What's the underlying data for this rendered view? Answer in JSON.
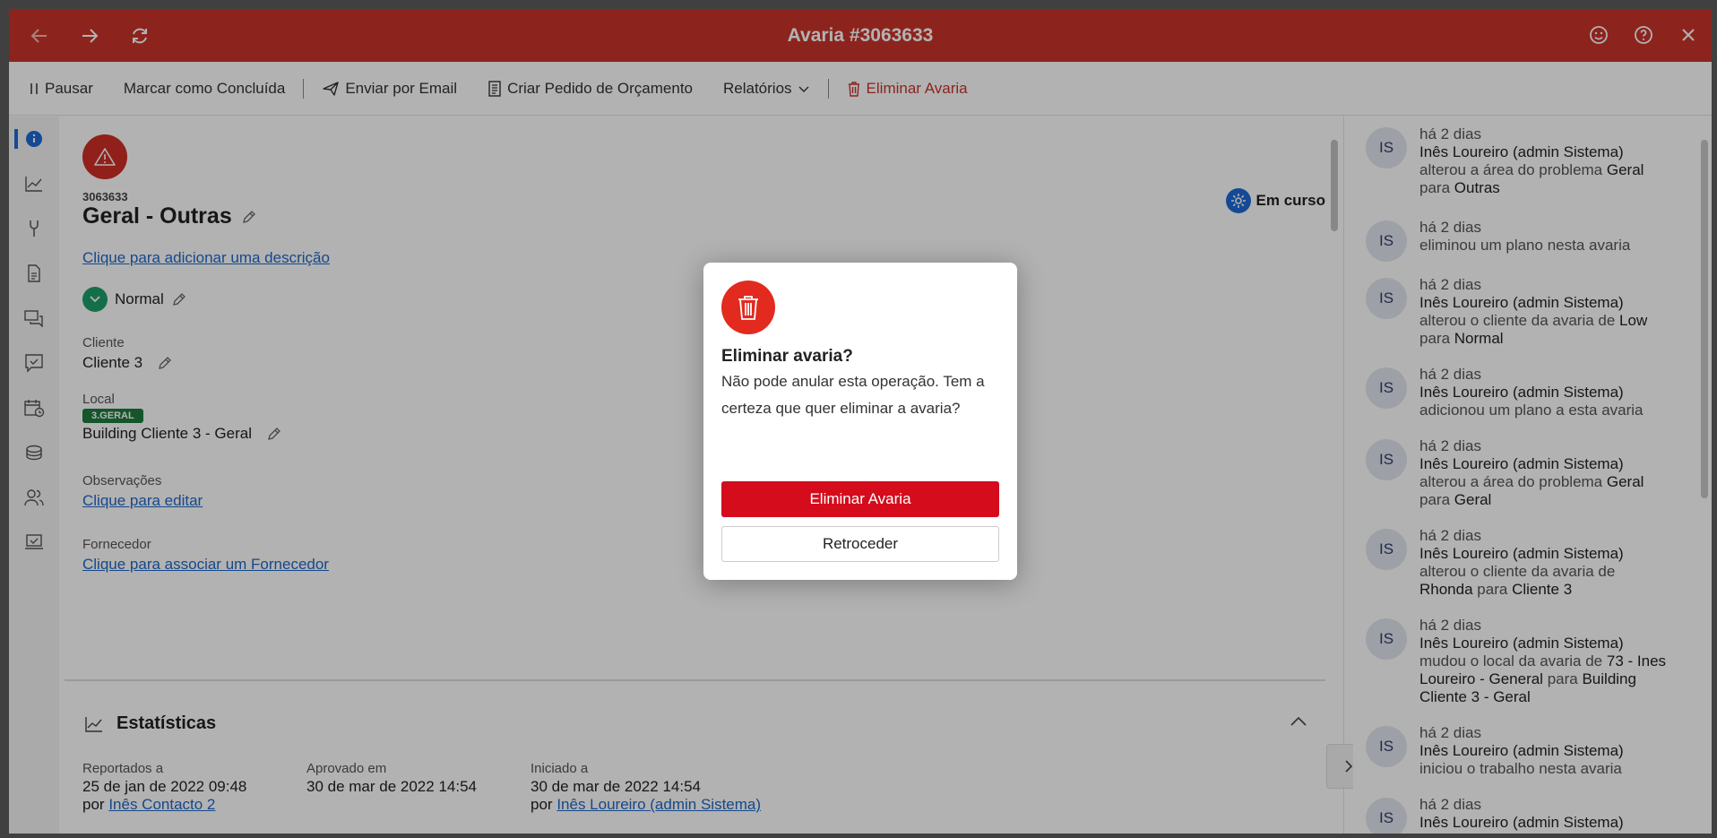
{
  "window": {
    "title": "Avaria #3063633"
  },
  "toolbar": {
    "pause": "Pausar",
    "mark_done": "Marcar como Concluída",
    "send_email": "Enviar por Email",
    "create_quote": "Criar Pedido de Orçamento",
    "reports": "Relatórios",
    "delete": "Eliminar Avaria"
  },
  "workorder": {
    "id": "3063633",
    "title": "Geral - Outras",
    "add_description": "Clique para adicionar uma descrição",
    "priority": "Normal",
    "status": "Em curso",
    "client_label": "Cliente",
    "client_value": "Cliente 3",
    "location_label": "Local",
    "location_badge": "3.GERAL",
    "location_value": "Building Cliente 3 - Geral",
    "notes_label": "Observações",
    "notes_link": "Clique para editar",
    "supplier_label": "Fornecedor",
    "supplier_link": "Clique para associar um Fornecedor"
  },
  "stats": {
    "title": "Estatísticas",
    "by_prefix": "por",
    "cols": [
      {
        "label": "Reportados a",
        "value": "25 de jan de 2022 09:48",
        "by": "Inês Contacto 2"
      },
      {
        "label": "Aprovado em",
        "value": "30 de mar de 2022 14:54",
        "by": ""
      },
      {
        "label": "Iniciado a",
        "value": "30 de mar de 2022 14:54",
        "by": "Inês Loureiro (admin Sistema)"
      }
    ]
  },
  "activity": {
    "items": [
      {
        "avatar": "IS",
        "time": "há 2 dias",
        "who": "Inês Loureiro (admin Sistema)",
        "text": "alterou a área do problema",
        "from": "Geral",
        "mid": "para",
        "to": "Outras"
      },
      {
        "avatar": "IS",
        "time": "há 2 dias",
        "who": "",
        "text": "eliminou um plano nesta avaria",
        "from": "",
        "mid": "",
        "to": ""
      },
      {
        "avatar": "IS",
        "time": "há 2 dias",
        "who": "Inês Loureiro (admin Sistema)",
        "text": "alterou o cliente da avaria de",
        "from": "Low",
        "mid": "para",
        "to": "Normal"
      },
      {
        "avatar": "IS",
        "time": "há 2 dias",
        "who": "Inês Loureiro (admin Sistema)",
        "text": "adicionou um plano a esta avaria",
        "from": "",
        "mid": "",
        "to": ""
      },
      {
        "avatar": "IS",
        "time": "há 2 dias",
        "who": "Inês Loureiro (admin Sistema)",
        "text": "alterou a área do problema",
        "from": "Geral",
        "mid": "para",
        "to": "Geral"
      },
      {
        "avatar": "IS",
        "time": "há 2 dias",
        "who": "Inês Loureiro (admin Sistema)",
        "text": "alterou o cliente da avaria de",
        "from": "Rhonda",
        "mid": "para",
        "to": "Cliente 3"
      },
      {
        "avatar": "IS",
        "time": "há 2 dias",
        "who": "Inês Loureiro (admin Sistema)",
        "text": "mudou o local da avaria de",
        "from": "73 - Ines Loureiro - General",
        "mid": "para",
        "to": "Building Cliente 3 - Geral"
      },
      {
        "avatar": "IS",
        "time": "há 2 dias",
        "who": "Inês Loureiro (admin Sistema)",
        "text": "iniciou o trabalho nesta avaria",
        "from": "",
        "mid": "",
        "to": ""
      },
      {
        "avatar": "IS",
        "time": "há 2 dias",
        "who": "Inês Loureiro (admin Sistema)",
        "text": "",
        "from": "",
        "mid": "",
        "to": ""
      }
    ]
  },
  "modal": {
    "title": "Eliminar avaria?",
    "message": "Não pode anular esta operação. Tem a certeza que quer eliminar a avaria?",
    "confirm": "Eliminar Avaria",
    "cancel": "Retroceder"
  },
  "colors": {
    "titlebar": "#c9342a",
    "danger_button": "#d40c1c",
    "link": "#1f68c8",
    "priority": "#1f9e6a",
    "badge": "#1f7a3e"
  }
}
